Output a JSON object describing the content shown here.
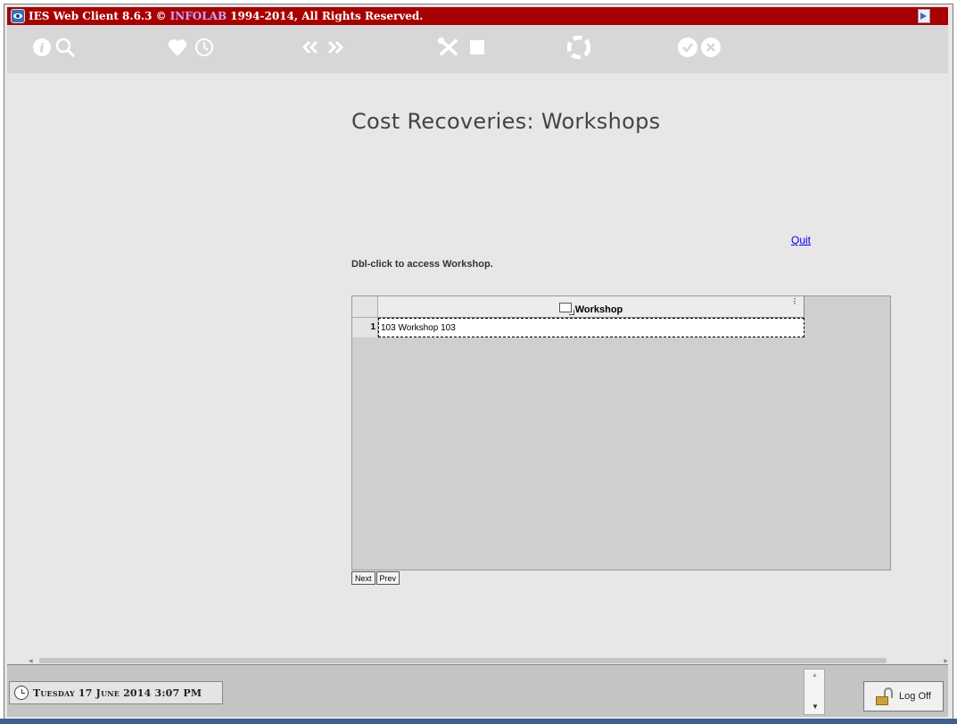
{
  "titlebar": {
    "app_name": "IES Web Client 8.6.3 ©",
    "brand": "INFOLAB",
    "copyright": "1994-2014, All Rights Reserved."
  },
  "toolbar": {
    "icons": [
      "info-icon",
      "search-icon",
      "favorite-icon",
      "history-icon",
      "previous-icon",
      "next-icon",
      "tools-icon",
      "stop-icon",
      "recycle-icon",
      "confirm-icon",
      "cancel-icon"
    ]
  },
  "main": {
    "title": "Cost Recoveries: Workshops",
    "quit_label": "Quit",
    "hint": "Dbl-click to access Workshop."
  },
  "grid": {
    "column_header": "Workshop",
    "rows": [
      {
        "num": "1",
        "value": "103 Workshop 103"
      }
    ],
    "next_label": "Next",
    "prev_label": "Prev"
  },
  "statusbar": {
    "date": "Tuesday 17 June 2014 3:07 PM",
    "logoff_label": "Log Off"
  },
  "colors": {
    "titlebar": "#a60000",
    "link": "#0000ee"
  }
}
